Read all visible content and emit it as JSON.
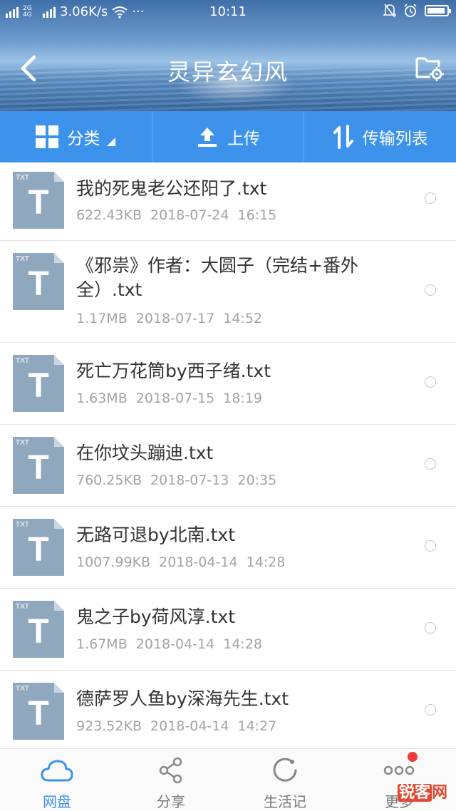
{
  "status_bar": {
    "network_small": "2G 4G",
    "speed": "3.06K/s",
    "dots": "···",
    "time": "10:11"
  },
  "header": {
    "title": "灵异玄幻风",
    "back_icon": "chevron-left-icon",
    "folder_settings_icon": "folder-settings-icon"
  },
  "toolbar": {
    "category_label": "分类",
    "upload_label": "上传",
    "transfer_label": "传输列表"
  },
  "files": [
    {
      "name": "我的死鬼老公还阳了.txt",
      "size": "622.43KB",
      "date": "2018-07-24",
      "time": "16:15",
      "ext": "TXT",
      "icon_letter": "T"
    },
    {
      "name": "《邪祟》作者：大圆子（完结+番外全）.txt",
      "size": "1.17MB",
      "date": "2018-07-17",
      "time": "14:52",
      "ext": "TXT",
      "icon_letter": "T"
    },
    {
      "name": "死亡万花筒by西子绪.txt",
      "size": "1.63MB",
      "date": "2018-07-15",
      "time": "18:19",
      "ext": "TXT",
      "icon_letter": "T"
    },
    {
      "name": "在你坟头蹦迪.txt",
      "size": "760.25KB",
      "date": "2018-07-13",
      "time": "20:35",
      "ext": "TXT",
      "icon_letter": "T"
    },
    {
      "name": "无路可退by北南.txt",
      "size": "1007.99KB",
      "date": "2018-04-14",
      "time": "14:28",
      "ext": "TXT",
      "icon_letter": "T"
    },
    {
      "name": "鬼之子by荷风淳.txt",
      "size": "1.67MB",
      "date": "2018-04-14",
      "time": "14:28",
      "ext": "TXT",
      "icon_letter": "T"
    },
    {
      "name": "德萨罗人鱼by深海先生.txt",
      "size": "923.52KB",
      "date": "2018-04-14",
      "time": "14:27",
      "ext": "TXT",
      "icon_letter": "T"
    }
  ],
  "bottom_nav": {
    "items": [
      {
        "label": "网盘",
        "icon": "cloud-icon",
        "active": true
      },
      {
        "label": "分享",
        "icon": "share-icon",
        "active": false
      },
      {
        "label": "生活记",
        "icon": "life-icon",
        "active": false
      },
      {
        "label": "更多",
        "icon": "more-icon",
        "active": false
      }
    ]
  },
  "watermark": {
    "text_a": "锐客",
    "text_b": "网"
  },
  "colors": {
    "accent": "#3d93ec",
    "badge": "#ee3b3b"
  }
}
